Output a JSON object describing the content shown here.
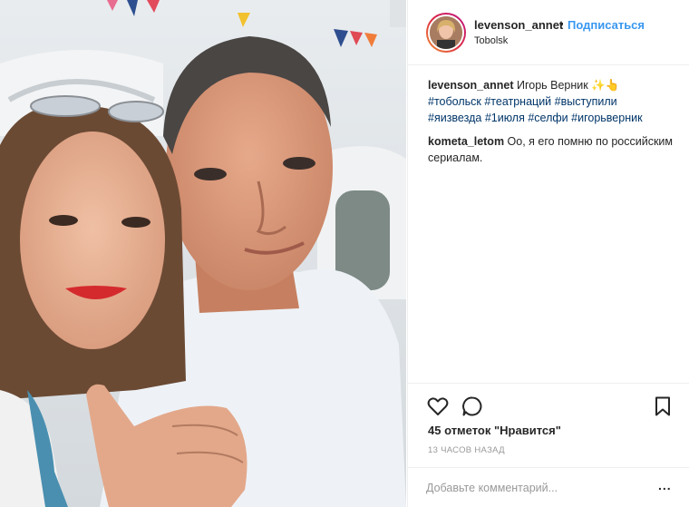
{
  "post": {
    "username": "levenson_annet",
    "follow_label": "Подписаться",
    "location": "Tobolsk",
    "separator": "•"
  },
  "comments": [
    {
      "user": "levenson_annet",
      "text": "Игорь Верник ✨👆",
      "tags": [
        "#тобольск",
        "#театрнаций",
        "#выступили",
        "#яизвезда",
        "#1июля",
        "#селфи",
        "#игорьверник"
      ]
    },
    {
      "user": "kometa_letom",
      "text": "Оо, я его помню по российским сериалам."
    }
  ],
  "stats": {
    "likes_text": "45 отметок \"Нравится\"",
    "time_text": "13 ЧАСОВ НАЗАД"
  },
  "add_comment": {
    "placeholder": "Добавьте комментарий...",
    "more_label": "..."
  },
  "icons": {
    "like": "heart-icon",
    "comment": "comment-icon",
    "save": "bookmark-icon"
  },
  "colors": {
    "link_blue": "#3897f0",
    "hashtag": "#003569",
    "muted": "#999999"
  }
}
